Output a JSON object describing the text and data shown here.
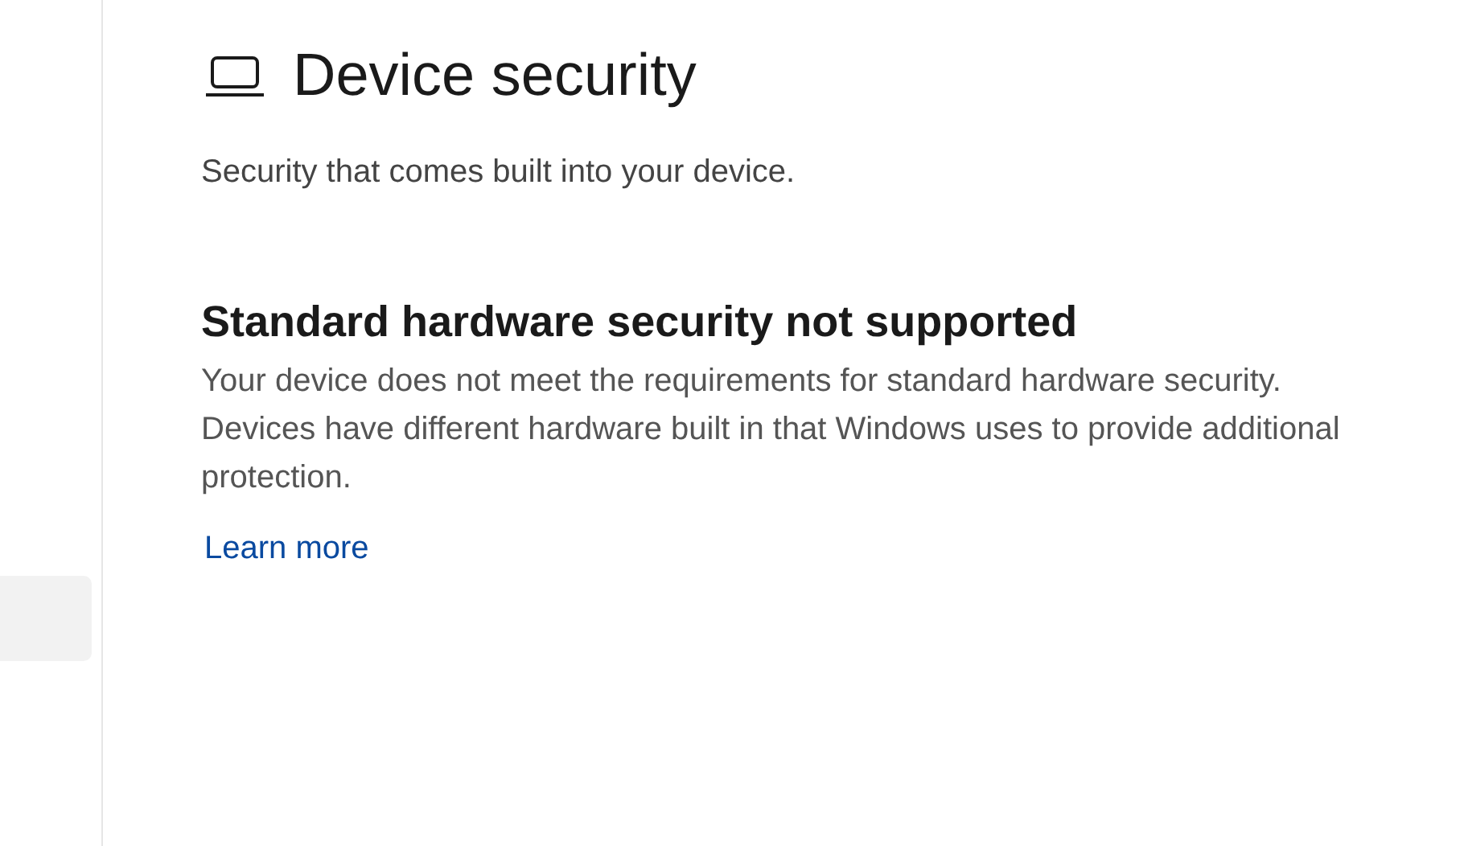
{
  "sidebar": {
    "items": [
      {
        "selected": true
      }
    ]
  },
  "page": {
    "title": "Device security",
    "subtitle": "Security that comes built into your device."
  },
  "section": {
    "heading": "Standard hardware security not supported",
    "body": "Your device does not meet the requirements for standard hardware security. Devices have different hardware built in that Windows uses to provide additional protection.",
    "link": "Learn more"
  }
}
